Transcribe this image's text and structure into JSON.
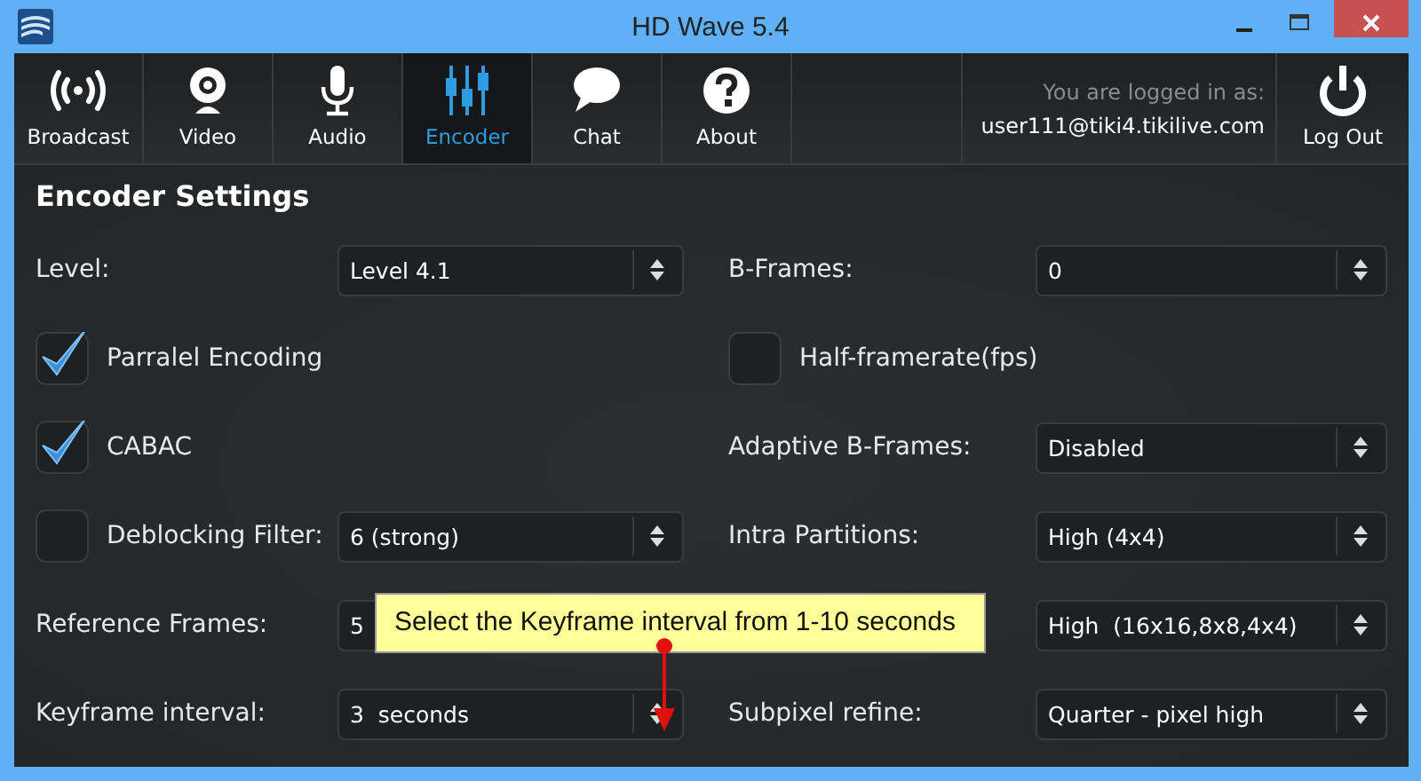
{
  "window": {
    "title": "HD Wave 5.4"
  },
  "tabs": [
    {
      "label": "Broadcast",
      "selected": false
    },
    {
      "label": "Video",
      "selected": false
    },
    {
      "label": "Audio",
      "selected": false
    },
    {
      "label": "Encoder",
      "selected": true
    },
    {
      "label": "Chat",
      "selected": false
    },
    {
      "label": "About",
      "selected": false
    }
  ],
  "login": {
    "caption": "You are logged in as:",
    "user": "user111@tiki4.tikilive.com"
  },
  "logout_button": "Log Out",
  "heading": "Encoder Settings",
  "left": [
    {
      "kind": "select",
      "label": "Level:",
      "value": "Level 4.1"
    },
    {
      "kind": "checkbox",
      "label": "Parralel Encoding",
      "checked": true
    },
    {
      "kind": "checkbox",
      "label": "CABAC",
      "checked": true
    },
    {
      "kind": "checkbox-select",
      "label": "Deblocking Filter:",
      "checked": false,
      "value": "6 (strong)"
    },
    {
      "kind": "select",
      "label": "Reference Frames:",
      "value": "5"
    },
    {
      "kind": "select",
      "label": "Keyframe interval:",
      "value": "3  seconds"
    }
  ],
  "right": [
    {
      "kind": "select",
      "label": "B-Frames:",
      "value": "0"
    },
    {
      "kind": "checkbox",
      "label": "Half-framerate(fps)",
      "checked": false
    },
    {
      "kind": "select",
      "label": "Adaptive B-Frames:",
      "value": "Disabled"
    },
    {
      "kind": "select",
      "label": "Intra Partitions:",
      "value": "High (4x4)"
    },
    {
      "kind": "select",
      "value": "High  (16x16,8x8,4x4)"
    },
    {
      "kind": "select",
      "label": "Subpixel refine:",
      "value": "Quarter - pixel high"
    }
  ],
  "tooltip": "Select the Keyframe interval from 1-10 seconds"
}
